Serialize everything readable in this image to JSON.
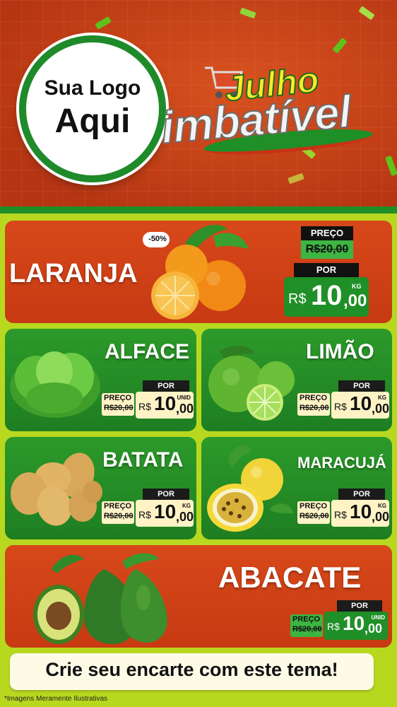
{
  "logo": {
    "line1": "Sua Logo",
    "line2": "Aqui"
  },
  "promo": {
    "line1": "Julho",
    "line2": "imbatível"
  },
  "main_product": {
    "name": "LARANJA",
    "discount": "-50%",
    "old_label": "PREÇO",
    "old_price": "R$20,00",
    "por_label": "POR",
    "currency": "R$",
    "price_int": "10",
    "price_cents": ",00",
    "unit": "KG"
  },
  "products": [
    {
      "name": "ALFACE",
      "preco_label": "PREÇO",
      "old_price": "R$20,00",
      "por_label": "POR",
      "currency": "R$",
      "price_int": "10",
      "price_cents": ",00",
      "unit": "UNID"
    },
    {
      "name": "LIMÃO",
      "preco_label": "PREÇO",
      "old_price": "R$20,00",
      "por_label": "POR",
      "currency": "R$",
      "price_int": "10",
      "price_cents": ",00",
      "unit": "KG"
    },
    {
      "name": "BATATA",
      "preco_label": "PREÇO",
      "old_price": "R$20,00",
      "por_label": "POR",
      "currency": "R$",
      "price_int": "10",
      "price_cents": ",00",
      "unit": "KG"
    },
    {
      "name": "MARACUJÁ",
      "preco_label": "PREÇO",
      "old_price": "R$20,00",
      "por_label": "POR",
      "currency": "R$",
      "price_int": "10",
      "price_cents": ",00",
      "unit": "KG"
    },
    {
      "name": "ABACATE",
      "preco_label": "PREÇO",
      "old_price": "R$20,00",
      "por_label": "POR",
      "currency": "R$",
      "price_int": "10",
      "price_cents": ",00",
      "unit": "UNID"
    }
  ],
  "footer": {
    "cta": "Crie seu encarte com este tema!",
    "disclaimer": "*Imagens Meramente Ilustrativas"
  },
  "colors": {
    "orange_card": "#d7481a",
    "green_card": "#2c9a2a",
    "price_green": "#1f8f27",
    "price_bg": "#fff3c6",
    "accent_lime": "#b8d820"
  }
}
